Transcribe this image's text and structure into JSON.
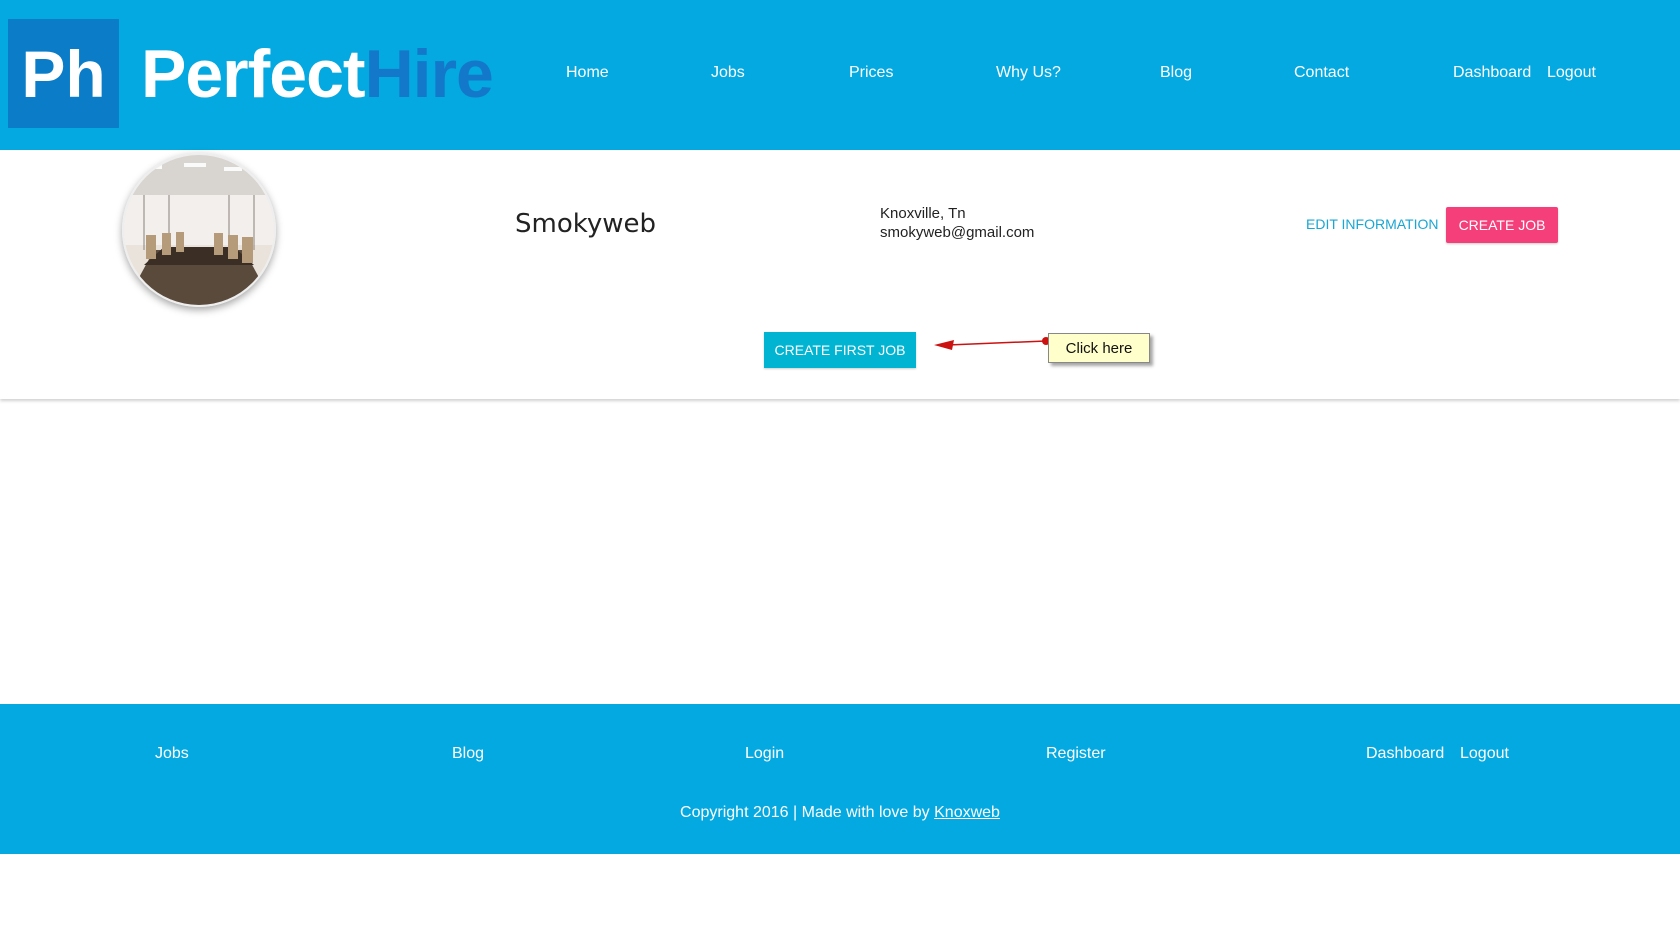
{
  "logo": {
    "mark": "Ph",
    "perfect": "Perfect",
    "hire": "Hire"
  },
  "nav": {
    "home": "Home",
    "jobs": "Jobs",
    "prices": "Prices",
    "why_us": "Why Us?",
    "blog": "Blog",
    "contact": "Contact",
    "dashboard": "Dashboard",
    "logout": "Logout"
  },
  "profile": {
    "name": "Smokyweb",
    "location": "Knoxville, Tn",
    "email": "smokyweb@gmail.com",
    "edit_label": "EDIT INFORMATION",
    "create_job_label": "CREATE JOB",
    "create_first_job_label": "CREATE FIRST JOB"
  },
  "annotation": {
    "callout_text": "Click here"
  },
  "footer": {
    "jobs": "Jobs",
    "blog": "Blog",
    "login": "Login",
    "register": "Register",
    "dashboard": "Dashboard",
    "logout": "Logout",
    "copyright_text": "Copyright 2016 | Made with love by ",
    "copyright_link": "Knoxweb"
  },
  "colors": {
    "brand_blue": "#03a9e0",
    "logo_dark": "#0a7cc8",
    "accent_pink": "#f43f7b",
    "cta_teal": "#00b4d2",
    "link_blue": "#1aa6d3"
  }
}
